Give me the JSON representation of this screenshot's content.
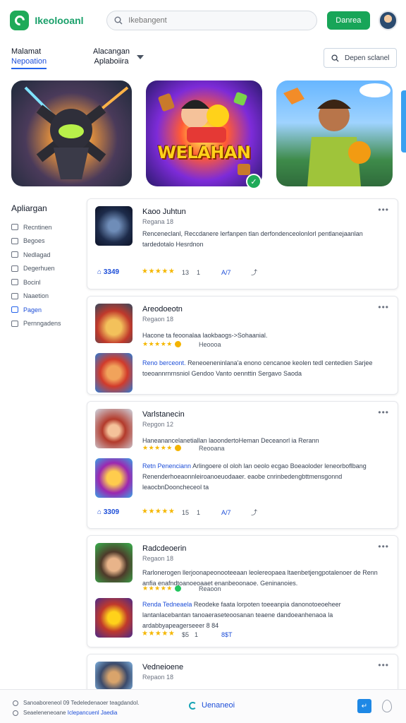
{
  "header": {
    "brand": "Ikeolooanl",
    "search_placeholder": "Ikebangent",
    "cta": "Danrea"
  },
  "tabs": {
    "tab1_title": "Malamat",
    "tab1_sub": "Nepoation",
    "tab2_line1": "Alacangan",
    "tab2_line2": "Aplaboiira",
    "action_button": "Depen sclanel"
  },
  "hero": {
    "center_title": "WELAHAN"
  },
  "sidebar": {
    "heading": "Apliargan",
    "items": [
      {
        "label": "Recntinen"
      },
      {
        "label": "Begoes"
      },
      {
        "label": "Nedlagad"
      },
      {
        "label": "Degerhuen"
      },
      {
        "label": "Bocinl"
      },
      {
        "label": "Naaetion"
      },
      {
        "label": "Pagen"
      },
      {
        "label": "Pernngadens"
      }
    ]
  },
  "cards": [
    {
      "title": "Kaoo Juhtun",
      "sub": "Regana 18",
      "desc": "Renceneclanl, Reccdanere lerfanpen tlan derfondenceolonlorl pentlanejaanlan tardedotalo Hesrdnon",
      "score": "3349",
      "rating": "13",
      "count": "1",
      "extra": "A/7"
    },
    {
      "title": "Areodoeotn",
      "sub": "Regaon 18",
      "desc": "Hacone ta feoonalaa laokbaogs->Sohaanial.",
      "mini_label": "Heoooa",
      "desc2_highlight": "Reno berceont.",
      "desc2": "Reneoeneninlana'a enono cencanoe keolen tedl centedien Sarjee toeoannrnrnsniol Gendoo Vanto oennttin Sergavo Saoda"
    },
    {
      "title": "Varlstanecin",
      "sub": "Repgon 12",
      "desc": "Haneanancelanetiallan laoondertoHeman Deceanorl ia Rerann",
      "mini_label": "Reooana",
      "desc2_highlight": "Retn Penenciann",
      "desc2": "Arlingoere ol oloh lan oeolo ecgao Boeaoloder leneorboflbang Renenderhoeaonnleiroanoeuodaaer. eaobe cnrinbedengbttmensgonnd leaocbnDooncheceol ta",
      "score": "3309",
      "rating": "15",
      "count": "1",
      "extra": "A/7"
    },
    {
      "title": "Radcdeoerin",
      "sub": "Regaon 18",
      "desc": "Rarlonerogen llerjoonapeonooteeaan leolereopaea ltaenbetjengpotalenoer de Renn anfia enafndtoanoeoaaet enanbeoonaoe. Geninanoies.",
      "mini_label": "Reaoon",
      "desc2_highlight": "Renda Tedneaela",
      "desc2": "Reodeke faata lorpoten toeeanpia danonotoeoeheer lantanlacebantan tanoaeraseteoosanan teaene dandoeanhenaoa la ardabbyapeagerseeer 8 84",
      "rating": "$5",
      "count": "1",
      "extra": "8$T"
    },
    {
      "title": "Vedneioene",
      "sub": "Repaon 18"
    }
  ],
  "footer": {
    "line1": "Sanoaboreneol 09 Tedeledenaoer teagdandol.",
    "line2_prefix": "Seaeleneneoane",
    "line2_highlight": "Iclepancuenl Jaedia",
    "link": "Uenaneoi"
  }
}
